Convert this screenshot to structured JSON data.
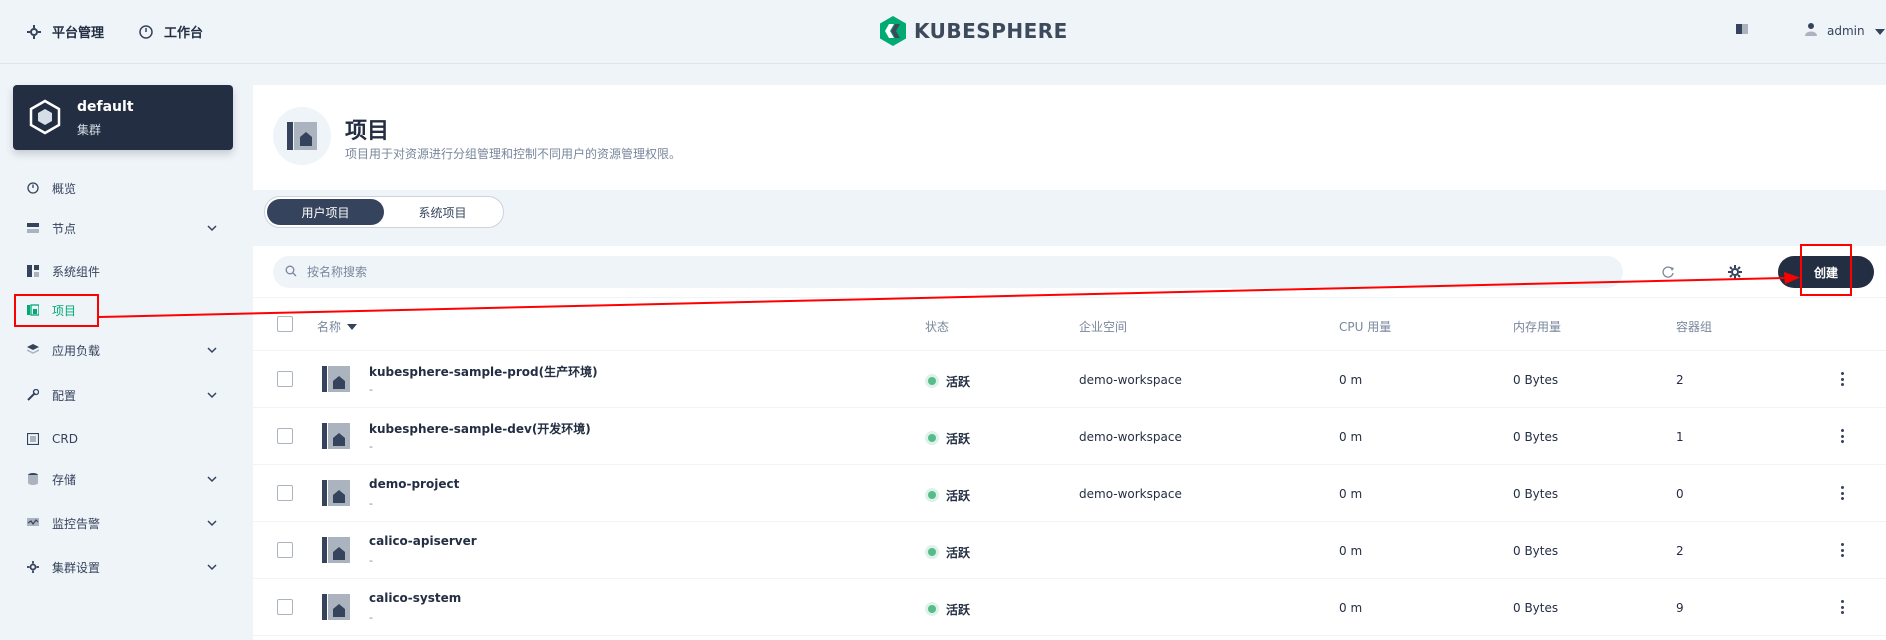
{
  "topbar": {
    "platform_label": "平台管理",
    "workbench_label": "工作台",
    "logo_text": "KUBESPHERE",
    "user_label": "admin"
  },
  "cluster": {
    "name": "default",
    "type": "集群"
  },
  "sidebar": {
    "items": [
      {
        "label": "概览",
        "icon": "dashboard-icon",
        "expandable": false
      },
      {
        "label": "节点",
        "icon": "server-icon",
        "expandable": true
      },
      {
        "label": "系统组件",
        "icon": "components-icon",
        "expandable": false
      },
      {
        "label": "项目",
        "icon": "project-icon",
        "expandable": false,
        "active": true
      },
      {
        "label": "应用负载",
        "icon": "stack-icon",
        "expandable": true
      },
      {
        "label": "配置",
        "icon": "wrench-icon",
        "expandable": true
      },
      {
        "label": "CRD",
        "icon": "crd-icon",
        "expandable": false
      },
      {
        "label": "存储",
        "icon": "database-icon",
        "expandable": true
      },
      {
        "label": "监控告警",
        "icon": "monitor-icon",
        "expandable": true
      },
      {
        "label": "集群设置",
        "icon": "gear-icon",
        "expandable": true
      }
    ]
  },
  "banner": {
    "title": "项目",
    "description": "项目用于对资源进行分组管理和控制不同用户的资源管理权限。"
  },
  "tabs": [
    {
      "label": "用户项目",
      "active": true
    },
    {
      "label": "系统项目",
      "active": false
    }
  ],
  "toolbar": {
    "search_placeholder": "按名称搜索",
    "create_label": "创建"
  },
  "table": {
    "columns": [
      "名称",
      "状态",
      "企业空间",
      "CPU 用量",
      "内存用量",
      "容器组"
    ],
    "rows": [
      {
        "name": "kubesphere-sample-prod(生产环境)",
        "desc": "-",
        "status": "活跃",
        "workspace": "demo-workspace",
        "cpu": "0 m",
        "memory": "0 Bytes",
        "pods": "2"
      },
      {
        "name": "kubesphere-sample-dev(开发环境)",
        "desc": "-",
        "status": "活跃",
        "workspace": "demo-workspace",
        "cpu": "0 m",
        "memory": "0 Bytes",
        "pods": "1"
      },
      {
        "name": "demo-project",
        "desc": "-",
        "status": "活跃",
        "workspace": "demo-workspace",
        "cpu": "0 m",
        "memory": "0 Bytes",
        "pods": "0"
      },
      {
        "name": "calico-apiserver",
        "desc": "-",
        "status": "活跃",
        "workspace": "",
        "cpu": "0 m",
        "memory": "0 Bytes",
        "pods": "2"
      },
      {
        "name": "calico-system",
        "desc": "-",
        "status": "活跃",
        "workspace": "",
        "cpu": "0 m",
        "memory": "0 Bytes",
        "pods": "9"
      }
    ]
  },
  "colors": {
    "active_green": "#00aa72",
    "status_green": "#55bc8a",
    "annotation_red": "#ff0000",
    "dark": "#242e42"
  }
}
